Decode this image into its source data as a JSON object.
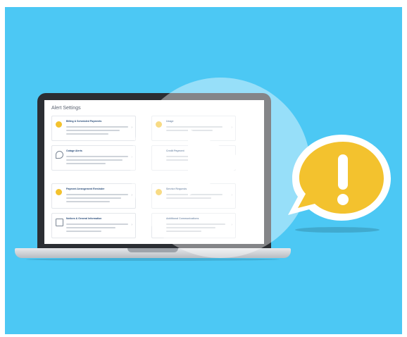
{
  "screen": {
    "title": "Alert Settings",
    "cards_left": [
      {
        "title": "Billing & Scheduled Payments",
        "icon": "sun-icon"
      },
      {
        "title": "Outage Alerts",
        "icon": "drop-icon"
      },
      {
        "title": "Payment Arrangement Reminder",
        "icon": "sun-icon"
      },
      {
        "title": "Notices & General Information",
        "icon": "document-icon"
      }
    ],
    "cards_right": [
      {
        "title": "Usage",
        "icon": "sun-icon"
      },
      {
        "title": "Credit Payment",
        "icon": "none"
      },
      {
        "title": "Service Requests",
        "icon": "sun-icon"
      },
      {
        "title": "Additional Communications",
        "icon": "none"
      }
    ]
  },
  "alert_bubble": {
    "symbol": "!",
    "color": "#f3c22e"
  },
  "colors": {
    "background": "#4cc8f4",
    "accent_yellow": "#f3c22e"
  }
}
